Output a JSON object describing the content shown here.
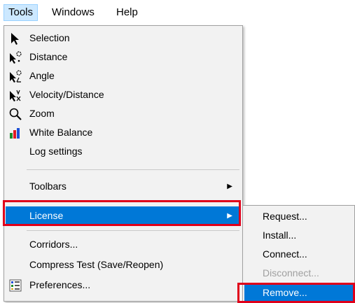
{
  "menubar": {
    "items": [
      "Tools",
      "Windows",
      "Help"
    ]
  },
  "tools_menu": {
    "items": [
      {
        "label": "Selection",
        "icon": "pointer-arrow-icon"
      },
      {
        "label": "Distance",
        "icon": "distance-measure-icon"
      },
      {
        "label": "Angle",
        "icon": "angle-measure-icon"
      },
      {
        "label": "Velocity/Distance",
        "icon": "velocity-distance-icon"
      },
      {
        "label": "Zoom",
        "icon": "magnifier-icon"
      },
      {
        "label": "White Balance",
        "icon": "color-bars-icon"
      },
      {
        "label": "Log settings",
        "icon": ""
      },
      {
        "label": "Toolbars",
        "icon": ""
      },
      {
        "label": "License",
        "icon": ""
      },
      {
        "label": "Corridors...",
        "icon": ""
      },
      {
        "label": "Compress Test (Save/Reopen)",
        "icon": ""
      },
      {
        "label": "Preferences...",
        "icon": "preferences-icon"
      }
    ]
  },
  "license_submenu": {
    "items": [
      {
        "label": "Request...",
        "enabled": true
      },
      {
        "label": "Install...",
        "enabled": true
      },
      {
        "label": "Connect...",
        "enabled": true
      },
      {
        "label": "Disconnect...",
        "enabled": false
      },
      {
        "label": "Remove...",
        "enabled": true
      }
    ]
  },
  "colors": {
    "highlight": "#0078d7",
    "annotation": "#e0001a",
    "menubar_selected": "#cce8ff"
  }
}
